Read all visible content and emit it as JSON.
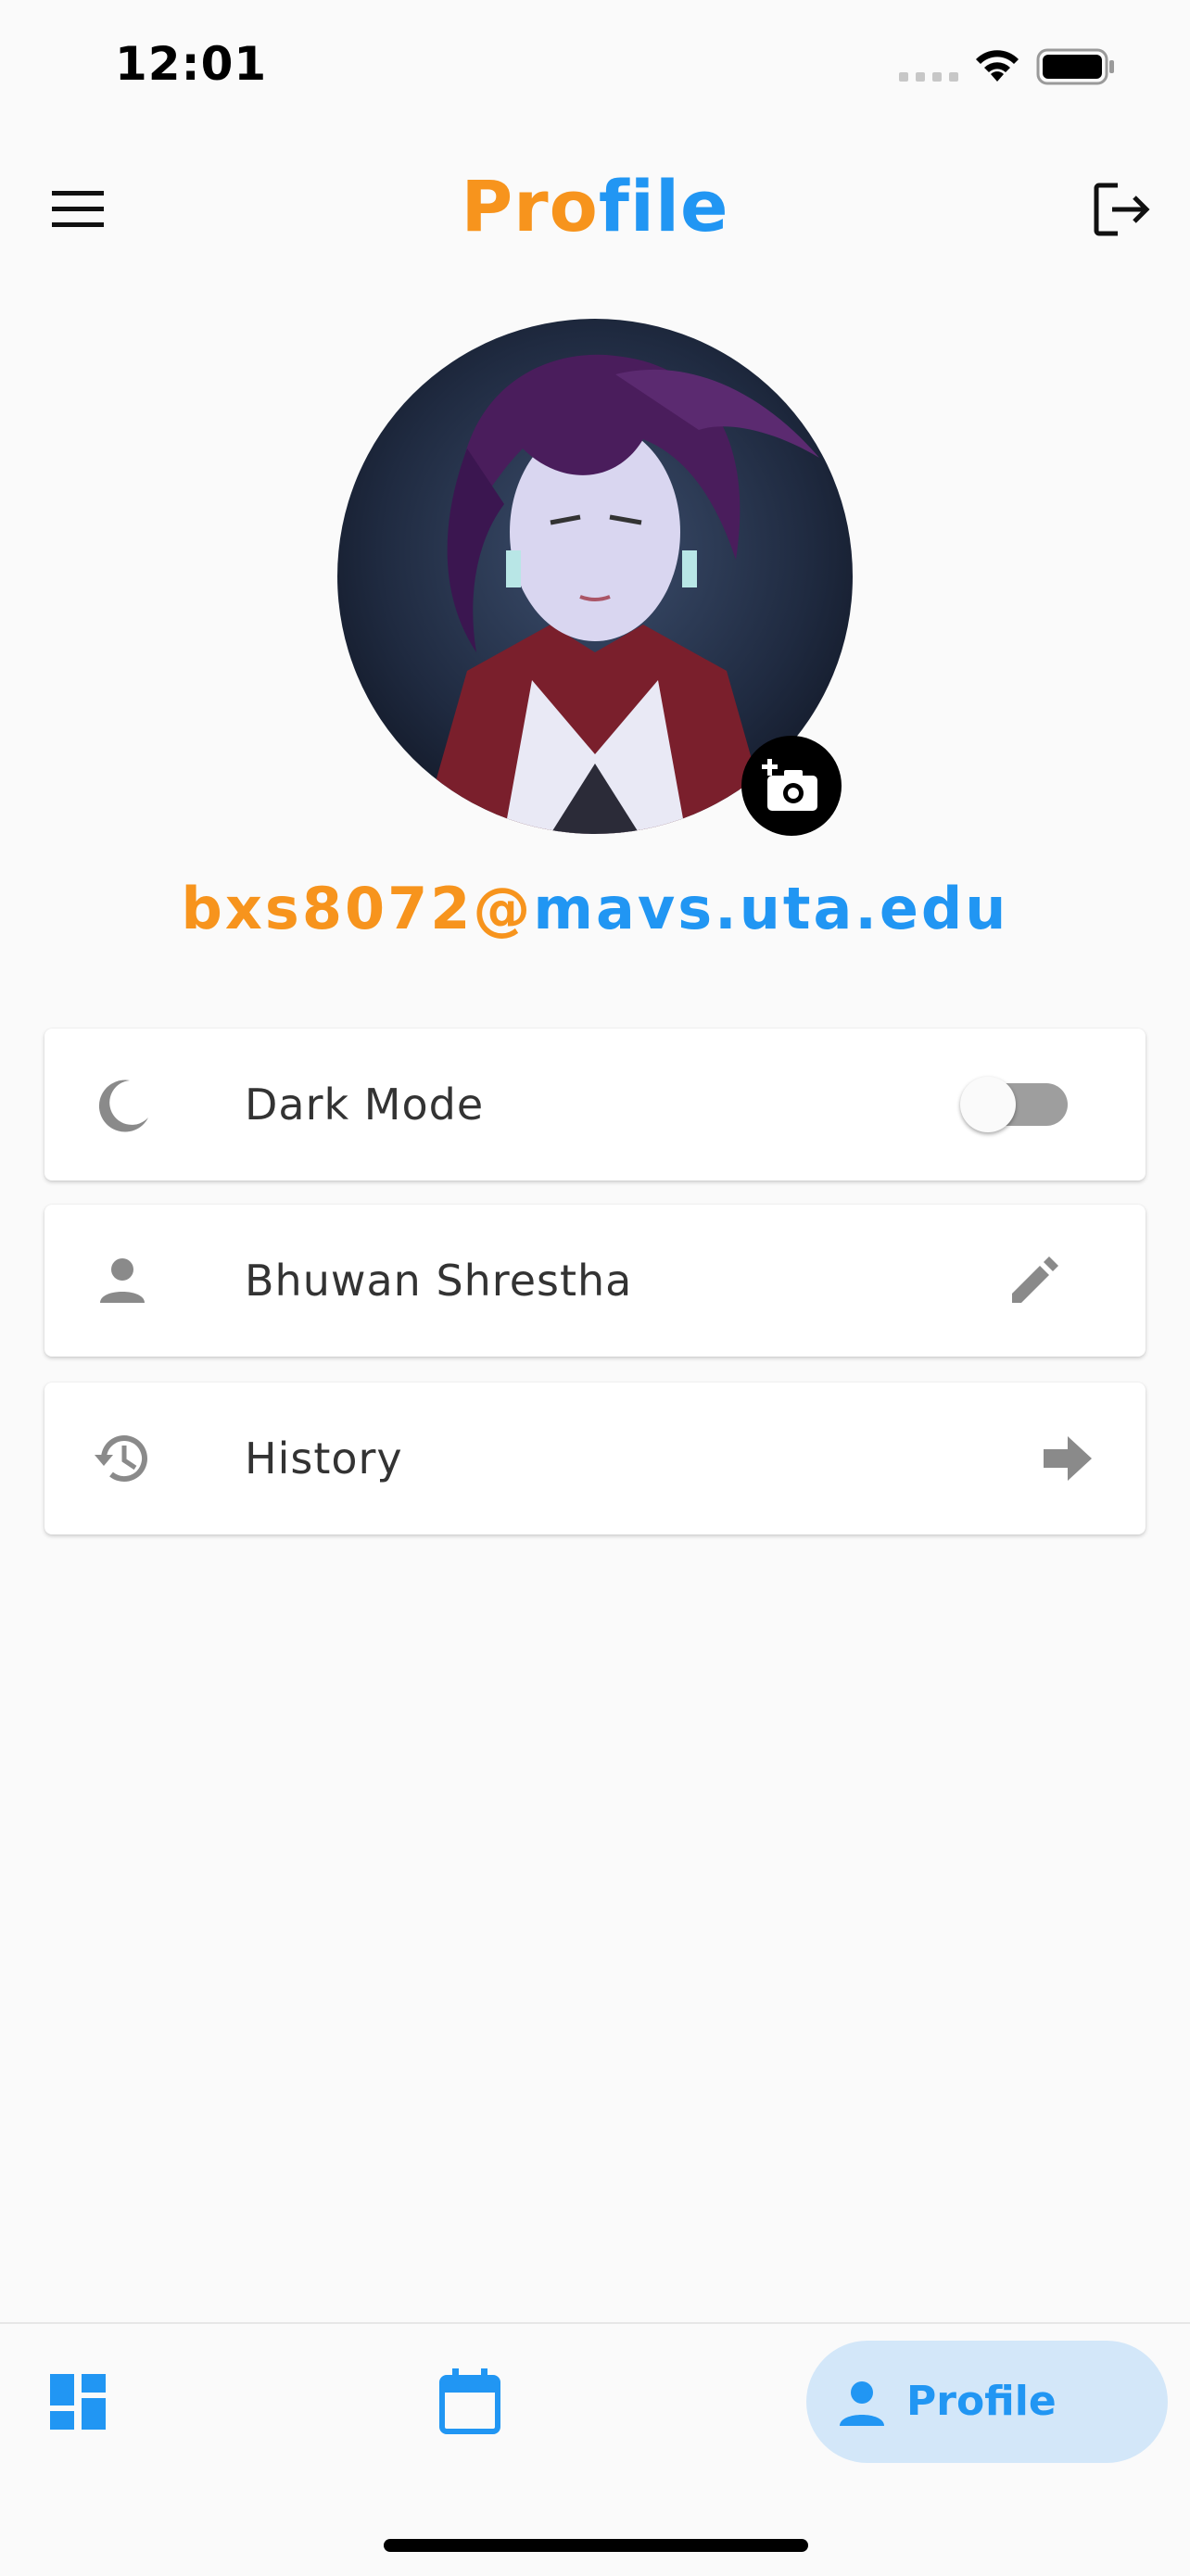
{
  "status_bar": {
    "time": "12:01"
  },
  "header": {
    "title_part1": "Pro",
    "title_part2": "file"
  },
  "user": {
    "email_part1": "bxs8072@",
    "email_part2": "mavs.uta.edu"
  },
  "settings": {
    "dark_mode_label": "Dark Mode",
    "dark_mode_on": false,
    "name_label": "Bhuwan Shrestha",
    "history_label": "History"
  },
  "bottom_nav": {
    "active_label": "Profile"
  },
  "colors": {
    "accent_orange": "#f7941d",
    "accent_blue": "#2196f3",
    "icon_gray": "#8a8a8a"
  },
  "icons": [
    "signal-icon",
    "wifi-icon",
    "battery-icon",
    "menu-icon",
    "logout-icon",
    "camera-add-icon",
    "moon-icon",
    "person-icon",
    "edit-icon",
    "history-icon",
    "arrow-forward-icon",
    "dashboard-icon",
    "calendar-icon"
  ]
}
